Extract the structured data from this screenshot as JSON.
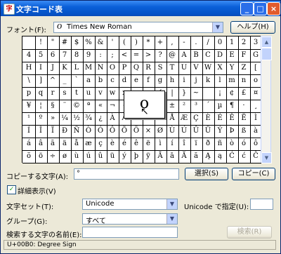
{
  "window": {
    "title": "文字コード表",
    "icon_glyph": "字"
  },
  "title_buttons": {
    "minimize": "_",
    "maximize": "□",
    "close": "×"
  },
  "font": {
    "label": "フォント(F):",
    "value": "Times New Roman",
    "glyph": "O",
    "help_label": "ヘルプ(H)"
  },
  "grid": {
    "rows": [
      [
        " ",
        "!",
        "\"",
        "#",
        "$",
        "%",
        "&",
        "'",
        "(",
        ")",
        "*",
        "+",
        ",",
        "-",
        ".",
        "/",
        "0",
        "1",
        "2",
        "3"
      ],
      [
        "4",
        "5",
        "6",
        "7",
        "8",
        "9",
        ":",
        ";",
        "<",
        "=",
        ">",
        "?",
        "@",
        "A",
        "B",
        "C",
        "D",
        "E",
        "F",
        "G"
      ],
      [
        "H",
        "I",
        "J",
        "K",
        "L",
        "M",
        "N",
        "O",
        "P",
        "Q",
        "R",
        "S",
        "T",
        "U",
        "V",
        "W",
        "X",
        "Y",
        "Z",
        "["
      ],
      [
        "\\",
        "]",
        "^",
        "_",
        "`",
        "a",
        "b",
        "c",
        "d",
        "e",
        "f",
        "g",
        "h",
        "i",
        "j",
        "k",
        "l",
        "m",
        "n",
        "o"
      ],
      [
        "p",
        "q",
        "r",
        "s",
        "t",
        "u",
        "v",
        "w",
        "x",
        "y",
        "z",
        "{",
        "|",
        "}",
        "~",
        " ",
        "¡",
        "¢",
        "£",
        "¤"
      ],
      [
        "¥",
        "¦",
        "§",
        "¨",
        "©",
        "ª",
        "«",
        "¬",
        "-",
        "®",
        "¯",
        "°",
        "±",
        "²",
        "³",
        "´",
        "µ",
        "¶",
        "·",
        "¸"
      ],
      [
        "¹",
        "º",
        "»",
        "¼",
        "½",
        "¾",
        "¿",
        "À",
        "Á",
        "Â",
        "Ã",
        "Ä",
        "Å",
        "Æ",
        "Ç",
        "È",
        "É",
        "Ê",
        "Ë",
        "Ì"
      ],
      [
        "Í",
        "Î",
        "Ï",
        "Ð",
        "Ñ",
        "Ò",
        "Ó",
        "Ô",
        "Õ",
        "Ö",
        "×",
        "Ø",
        "Ù",
        "Ú",
        "Û",
        "Ü",
        "Ý",
        "Þ",
        "ß",
        "à"
      ],
      [
        "á",
        "â",
        "ã",
        "ä",
        "å",
        "æ",
        "ç",
        "è",
        "é",
        "ê",
        "ë",
        "ì",
        "í",
        "î",
        "ï",
        "ð",
        "ñ",
        "ò",
        "ó",
        "ô"
      ],
      [
        "õ",
        "ö",
        "÷",
        "ø",
        "ù",
        "ú",
        "û",
        "ü",
        "ý",
        "þ",
        "ÿ",
        "Ā",
        "ā",
        "Ă",
        "ă",
        "Ą",
        "ą",
        "Ć",
        "ć",
        "Ĉ"
      ]
    ],
    "magnified_char": "o"
  },
  "copy": {
    "label": "コピーする文字(A):",
    "value": "°",
    "select_label": "選択(S)",
    "copy_label": "コピー(C)"
  },
  "advanced": {
    "checkbox_label": "詳細表示(V)",
    "checked": true,
    "check_glyph": "✓"
  },
  "charset": {
    "label": "文字セット(T):",
    "value": "Unicode",
    "unicode_label": "Unicode で指定(U):",
    "unicode_value": ""
  },
  "group": {
    "label": "グループ(G):",
    "value": "すべて"
  },
  "search": {
    "label": "検索する文字の名前(E):",
    "value": "",
    "button_label": "検索(R)"
  },
  "status_text": "U+00B0: Degree Sign",
  "icons": {
    "dropdown": "▼",
    "scroll_up": "▲",
    "scroll_down": "▼",
    "cursor": "↖"
  }
}
